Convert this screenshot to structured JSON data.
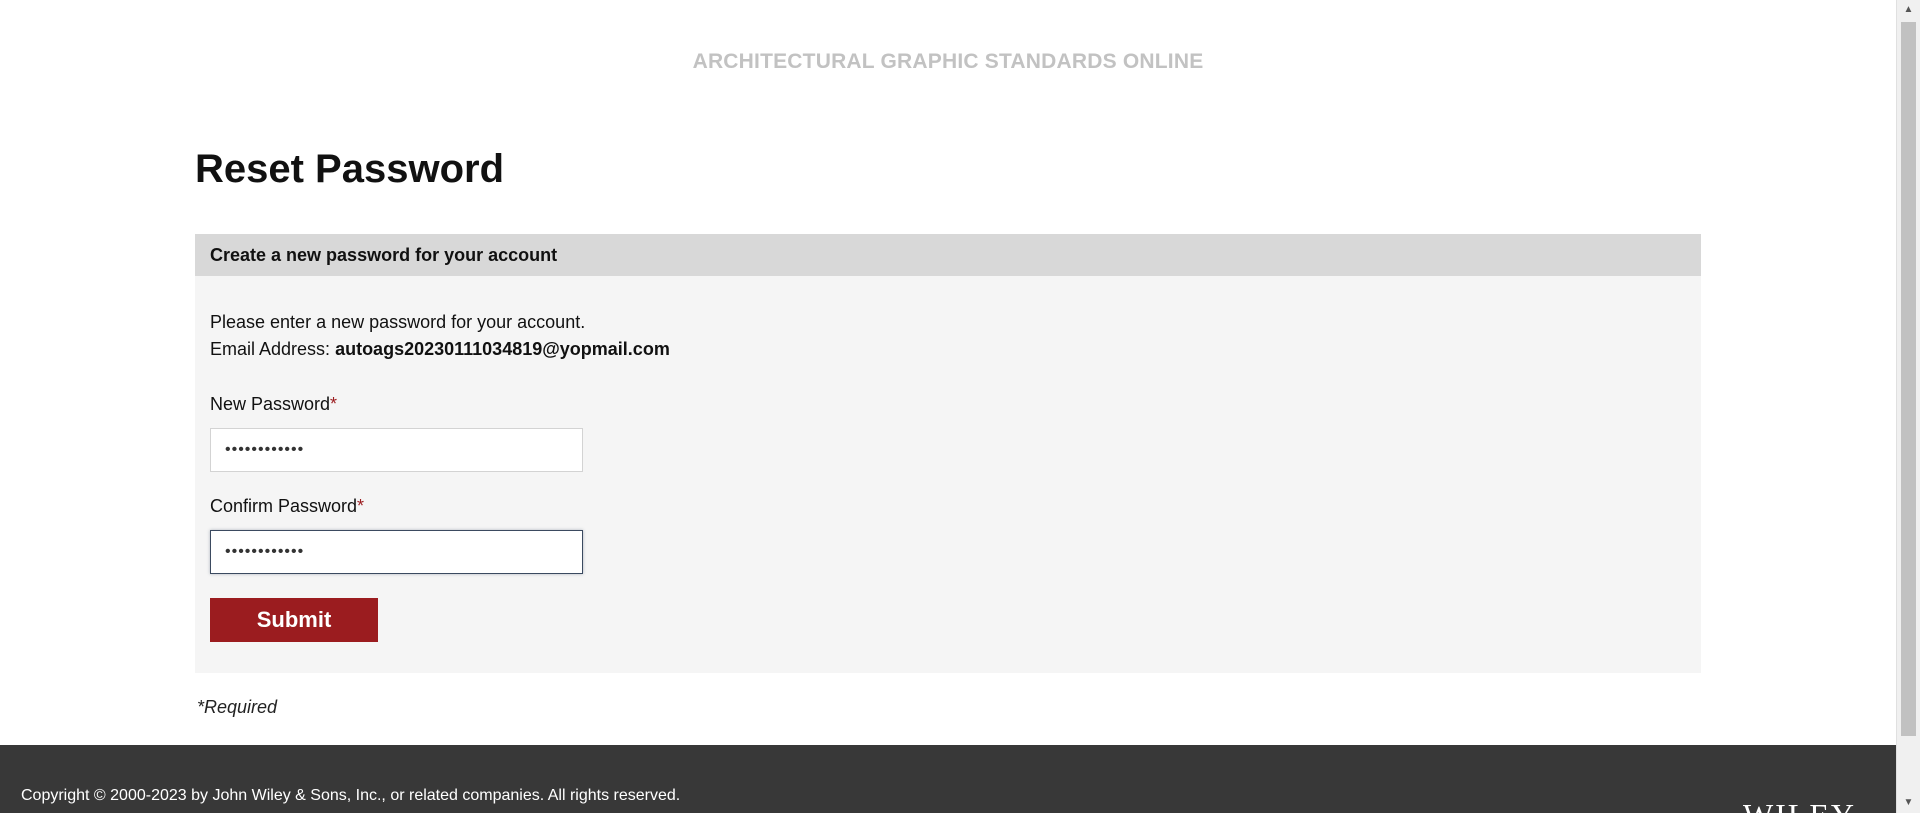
{
  "header": {
    "site_title": "ARCHITECTURAL GRAPHIC STANDARDS ONLINE"
  },
  "page": {
    "title": "Reset Password"
  },
  "panel": {
    "header": "Create a new password for your account",
    "intro_line": "Please enter a new password for your account.",
    "email_label": "Email Address: ",
    "email_value": "autoags20230111034819@yopmail.com"
  },
  "form": {
    "new_password": {
      "label": "New Password",
      "required_mark": "*",
      "value": "••••••••••••"
    },
    "confirm_password": {
      "label": "Confirm Password",
      "required_mark": "*",
      "value": "••••••••••••",
      "focused": true
    },
    "submit_label": "Submit",
    "required_note": "*Required"
  },
  "footer": {
    "copyright": "Copyright © 2000-2023 by John Wiley & Sons, Inc., or related companies. All rights reserved.",
    "logo_text": "WILEY"
  },
  "colors": {
    "accent": "#9b1c1f",
    "footer_bg": "#383838",
    "panel_bg": "#f5f5f5",
    "panel_header_bg": "#d8d8d8",
    "site_title": "#c2c2c2"
  },
  "icons": {
    "scroll_up": "triangle-up-icon",
    "scroll_down": "triangle-down-icon"
  }
}
